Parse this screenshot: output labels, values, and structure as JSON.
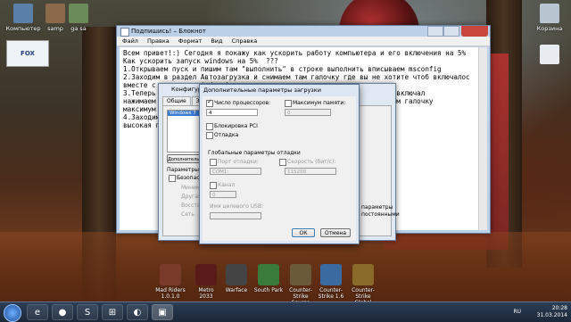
{
  "desktop_icons": [
    {
      "label": "Компьютер",
      "color": "#5a7fa8"
    },
    {
      "label": "samp",
      "color": "#8a6a4a"
    },
    {
      "label": "ga sa",
      "color": "#6a8a5a"
    },
    {
      "label": "Корзина",
      "color": "#b8c4d0"
    },
    {
      "label": "",
      "color": "#e8ecf0"
    }
  ],
  "notepad": {
    "title": "Подпишись! – Блокнот",
    "menu": [
      "Файл",
      "Правка",
      "Формат",
      "Вид",
      "Справка"
    ],
    "lines": [
      "Всем привет!:) Сегодня я покажу как ускорить работу компьютера и его включения на 5%",
      "Как ускорить запуск windows на 5%  ???",
      "1.Открываем пуск и пишим там \"выполнить\" в строке выполнить вписываем msconfig",
      "2.Заходим в раздел Автозагрузка и снимаем там галочку где вы не хотите чтоб включалос",
      "вместе с запуском windows!",
      "3.Теперь                                                      чтоб включал",
      "нажимаем                                                      ставим галочку",
      "максимум                                                                    ",
      "4.Заходим                                                      там",
      "высокая п"
    ]
  },
  "msconfig": {
    "title": "Конфигурация системы",
    "tabs": [
      "Общие",
      "Загрузка"
    ],
    "list_item": "Windows 7",
    "advanced_button": "Дополнительные параметры...",
    "params_label": "Параметры загрузки",
    "safe_mode": "Безопасный режим",
    "radios": [
      "Минимальная",
      "Другая оболочка",
      "Восстановление",
      "Сеть"
    ],
    "right_text": [
      "параметры",
      "постоянными"
    ]
  },
  "dialog": {
    "title": "Дополнительные параметры загрузки",
    "num_processors": "Число процессоров:",
    "num_processors_value": "4",
    "max_memory": "Максимум памяти:",
    "max_memory_value": "0",
    "pci_lock": "Блокировка PCI",
    "debug": "Отладка",
    "global_debug": "Глобальные параметры отладки",
    "debug_port": "Порт отладки:",
    "debug_port_value": "COM1:",
    "baud_rate": "Скорость (бит/с):",
    "baud_rate_value": "115200",
    "channel": "Канал",
    "channel_value": "0",
    "usb_target": "Имя целевого USB:",
    "ok": "ОК",
    "cancel": "Отмена"
  },
  "dock": [
    {
      "label": "Mad Riders 1.0.1.0",
      "color": "#7a3a2a"
    },
    {
      "label": "Metro 2033",
      "color": "#5a1a1a"
    },
    {
      "label": "Warface",
      "color": "#444"
    },
    {
      "label": "South Park",
      "color": "#3a7a3a"
    },
    {
      "label": "Counter-Strike Source",
      "color": "#6a5a3a"
    },
    {
      "label": "Counter-Strike 1.6",
      "color": "#3a6aa0"
    },
    {
      "label": "Counter-Strike Global Offe...",
      "color": "#8a6a2a"
    }
  ],
  "taskbar": {
    "items": [
      "e",
      "●",
      "S",
      "⊞",
      "◐",
      "▣"
    ],
    "language": "RU",
    "time": "20:28",
    "date": "31.03.2014"
  }
}
